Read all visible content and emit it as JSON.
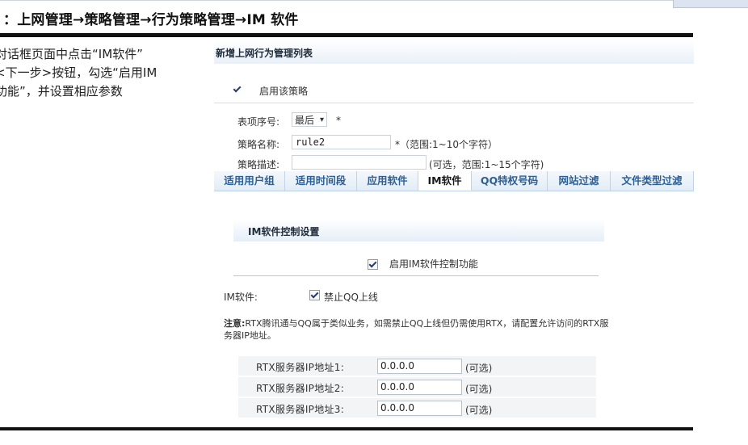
{
  "heading": "：上网管理→策略管理→行为策略管理→IM 软件",
  "instruction_lines": [
    "对话框页面中点击“IM软件”",
    "<下一步>按钮，勾选“启用IM",
    "功能”，并设置相应参数"
  ],
  "panel": {
    "title": "新增上网行为管理列表",
    "enable_policy": {
      "label": "启用该策略",
      "checked": true
    },
    "fields": {
      "index_label": "表项序号:",
      "index_value": "最后",
      "index_arrow": "▾",
      "required_mark": "*",
      "name_label": "策略名称:",
      "name_value": "rule2",
      "name_hint": "*（范围:1~10个字符）",
      "desc_label": "策略描述:",
      "desc_value": "",
      "desc_hint": "(可选，范围:1~15个字符)"
    },
    "tabs": [
      {
        "label": "适用用户组",
        "active": false
      },
      {
        "label": "适用时间段",
        "active": false
      },
      {
        "label": "应用软件",
        "active": false
      },
      {
        "label": "IM软件",
        "active": true
      },
      {
        "label": "QQ特权号码",
        "active": false
      },
      {
        "label": "网站过滤",
        "active": false
      },
      {
        "label": "文件类型过滤",
        "active": false
      }
    ]
  },
  "im_section": {
    "title": "IM软件控制设置",
    "enable_label": "启用IM软件控制功能",
    "enable_checked": true,
    "software_label": "IM软件:",
    "block_qq_label": "禁止QQ上线",
    "block_qq_checked": true,
    "notice_bold": "注意:",
    "notice_text": "RTX腾讯通与QQ属于类似业务，如需禁止QQ上线但仍需使用RTX，请配置允许访问的RTX服务器IP地址。",
    "rtx_servers": [
      {
        "label": "RTX服务器IP地址1:",
        "value": "0.0.0.0",
        "optional": "(可选)"
      },
      {
        "label": "RTX服务器IP地址2:",
        "value": "0.0.0.0",
        "optional": "(可选)"
      },
      {
        "label": "RTX服务器IP地址3:",
        "value": "0.0.0.0",
        "optional": "(可选)"
      }
    ]
  },
  "colors": {
    "tab_text": "#2e5f93",
    "required": "#e0373a",
    "rule": "#111111"
  }
}
